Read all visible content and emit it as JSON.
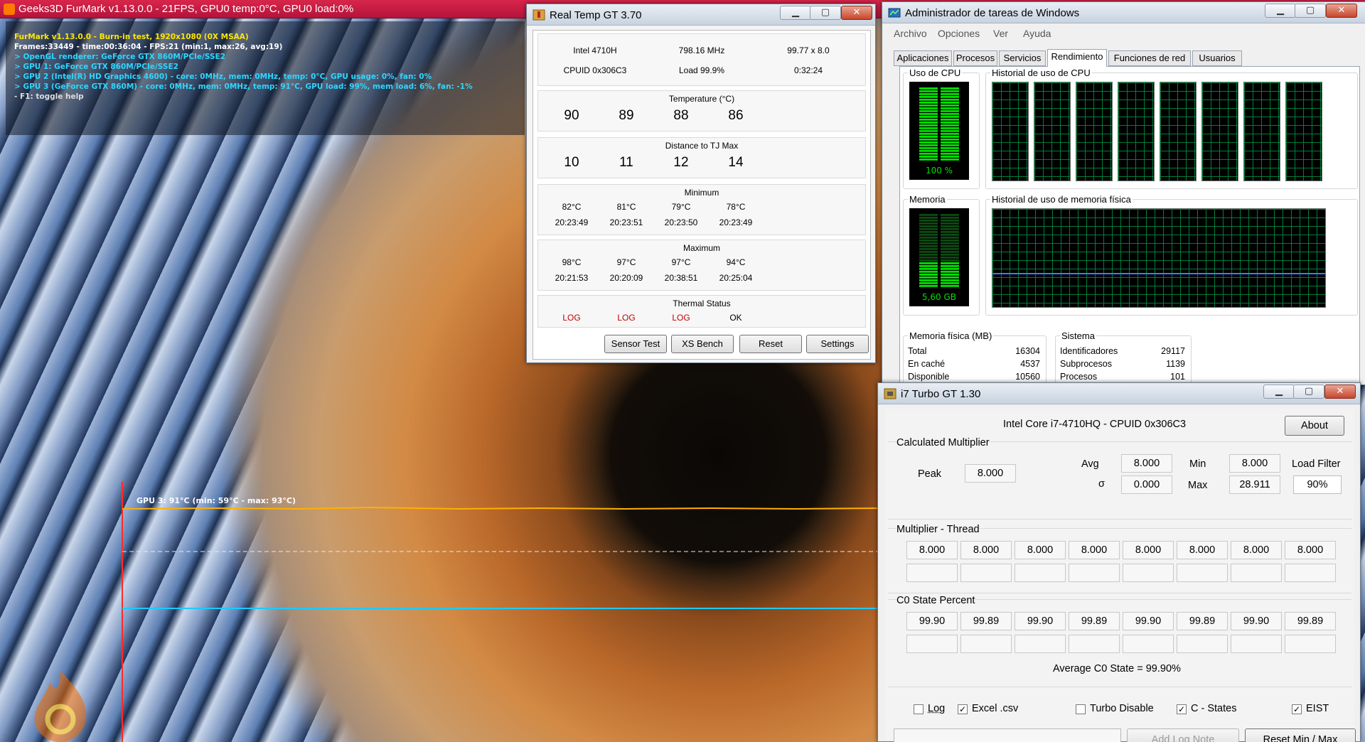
{
  "furmark": {
    "title": "Geeks3D FurMark v1.13.0.0 - 21FPS, GPU0 temp:0°C, GPU0 load:0%",
    "overlay_lines": [
      "FurMark v1.13.0.0 - Burn-in test, 1920x1080 (0X MSAA)",
      "Frames:33449 - time:00:36:04 - FPS:21 (min:1, max:26, avg:19)",
      "> OpenGL renderer: GeForce GTX 860M/PCIe/SSE2",
      "> GPU 1: GeForce GTX 860M/PCIe/SSE2",
      "> GPU 2 (Intel(R) HD Graphics 4600) - core: 0MHz, mem: 0MHz, temp: 0°C, GPU usage: 0%, fan: 0%",
      "> GPU 3 (GeForce GTX 860M) - core: 0MHz, mem: 0MHz, temp: 91°C, GPU load: 99%, mem load: 6%, fan: -1%",
      "- F1: toggle help"
    ],
    "graph_label": "GPU 3: 91°C (min: 59°C - max: 93°C)"
  },
  "realtemp": {
    "title": "Real Temp GT 3.70",
    "cpu": "Intel 4710H",
    "freq": "798.16 MHz",
    "multiplier": "99.77 x 8.0",
    "cpuid": "CPUID  0x306C3",
    "load": "Load  99.9%",
    "time": "0:32:24",
    "temperature_label": "Temperature (°C)",
    "temperatures": [
      "90",
      "89",
      "88",
      "86"
    ],
    "distance_label": "Distance to TJ Max",
    "distances": [
      "10",
      "11",
      "12",
      "14"
    ],
    "minimum_label": "Minimum",
    "minimum_temps": [
      "82°C",
      "81°C",
      "79°C",
      "78°C"
    ],
    "minimum_times": [
      "20:23:49",
      "20:23:51",
      "20:23:50",
      "20:23:49"
    ],
    "maximum_label": "Maximum",
    "maximum_temps": [
      "98°C",
      "97°C",
      "97°C",
      "94°C"
    ],
    "maximum_times": [
      "20:21:53",
      "20:20:09",
      "20:38:51",
      "20:25:04"
    ],
    "thermal_label": "Thermal Status",
    "thermal_status": [
      "LOG",
      "LOG",
      "LOG",
      "OK"
    ],
    "buttons": [
      "Sensor Test",
      "XS Bench",
      "Reset",
      "Settings"
    ]
  },
  "taskmgr": {
    "title": "Administrador de tareas de Windows",
    "menu": [
      "Archivo",
      "Opciones",
      "Ver",
      "Ayuda"
    ],
    "tabs": [
      "Aplicaciones",
      "Procesos",
      "Servicios",
      "Rendimiento",
      "Funciones de red",
      "Usuarios"
    ],
    "active_tab": "Rendimiento",
    "cpu_usage_label": "Uso de CPU",
    "cpu_usage_value": "100 %",
    "cpu_usage_fraction": 1.0,
    "cpu_history_label": "Historial de uso de CPU",
    "memory_label": "Memoria",
    "memory_value": "5,60 GB",
    "memory_fraction": 0.34,
    "memory_history_label": "Historial de uso de memoria física",
    "physical_memory_label": "Memoria física (MB)",
    "physical_memory": [
      {
        "name": "Total",
        "value": "16304"
      },
      {
        "name": "En caché",
        "value": "4537"
      },
      {
        "name": "Disponible",
        "value": "10560"
      }
    ],
    "system_label": "Sistema",
    "system": [
      {
        "name": "Identificadores",
        "value": "29117"
      },
      {
        "name": "Subprocesos",
        "value": "1139"
      },
      {
        "name": "Procesos",
        "value": "101"
      }
    ],
    "colors": {
      "meter_green": "#00e000",
      "grid_green": "#008c40",
      "history_blue": "#3a7cff"
    }
  },
  "turbo": {
    "title": "i7 Turbo GT 1.30",
    "cpu_info": "Intel Core i7-4710HQ  -  CPUID 0x306C3",
    "about": "About",
    "calc_mult_label": "Calculated Multiplier",
    "peak_label": "Peak",
    "peak_value": "8.000",
    "avg_label": "Avg",
    "avg_value": "8.000",
    "sigma_label": "σ",
    "sigma_value": "0.000",
    "min_label": "Min",
    "min_value": "8.000",
    "max_label": "Max",
    "max_value": "28.911",
    "load_filter_label": "Load Filter",
    "load_filter_value": "90%",
    "mult_thread_label": "Multiplier - Thread",
    "mult_thread_values": [
      "8.000",
      "8.000",
      "8.000",
      "8.000",
      "8.000",
      "8.000",
      "8.000",
      "8.000"
    ],
    "c0_label": "C0 State Percent",
    "c0_values": [
      "99.90",
      "99.89",
      "99.90",
      "99.89",
      "99.90",
      "99.89",
      "99.90",
      "99.89"
    ],
    "avg_c0": "Average C0 State = 99.90%",
    "checkboxes": [
      {
        "label": "Log",
        "checked": false
      },
      {
        "label": "Excel .csv",
        "checked": true
      },
      {
        "label": "Turbo Disable",
        "checked": false
      },
      {
        "label": "C - States",
        "checked": true
      },
      {
        "label": "EIST",
        "checked": true
      }
    ],
    "add_log_note": "Add Log Note",
    "reset_min_max": "Reset Min / Max"
  }
}
